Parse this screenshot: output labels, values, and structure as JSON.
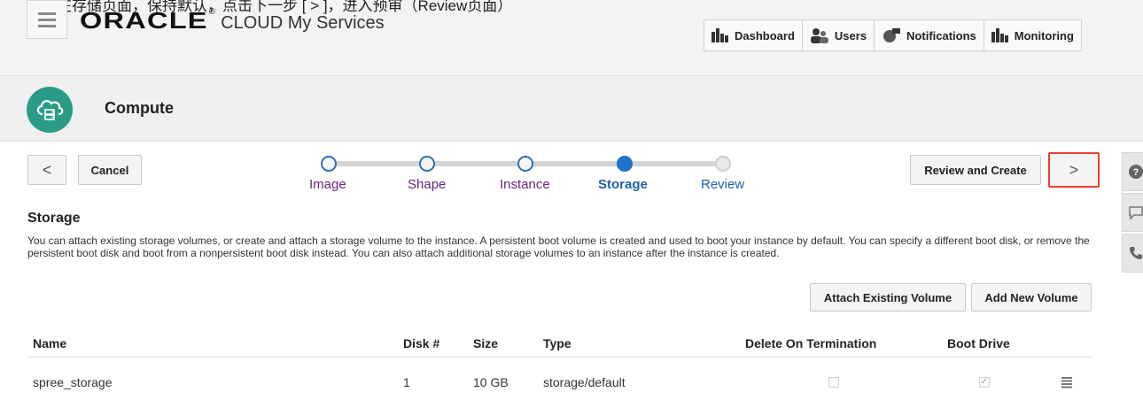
{
  "annotation": {
    "text": "在存储页面，保持默认，点击下一步 [ > ]，进入预审（Review页面）"
  },
  "header": {
    "brand_logo": "ORACLE",
    "brand_trademark": "®",
    "brand_rest": "CLOUD My Services",
    "nav": [
      {
        "label": "Dashboard",
        "icon": "bar-chart-icon"
      },
      {
        "label": "Users",
        "icon": "users-icon"
      },
      {
        "label": "Notifications",
        "icon": "notifications-icon"
      },
      {
        "label": "Monitoring",
        "icon": "bar-chart-icon"
      }
    ]
  },
  "page": {
    "title": "Compute",
    "icon": "cloud-compute-icon",
    "accent_color": "#2a9c86"
  },
  "toolbar": {
    "back_label": "<",
    "cancel_label": "Cancel",
    "review_label": "Review and Create",
    "next_label": ">",
    "highlight_color": "#e8402f"
  },
  "train": {
    "steps": [
      {
        "label": "Image",
        "state": "visited"
      },
      {
        "label": "Shape",
        "state": "visited"
      },
      {
        "label": "Instance",
        "state": "visited"
      },
      {
        "label": "Storage",
        "state": "current"
      },
      {
        "label": "Review",
        "state": "future"
      }
    ]
  },
  "storage": {
    "title": "Storage",
    "description": "You can attach existing storage volumes, or create and attach a storage volume to the instance. A persistent boot volume is created and used to boot your instance by default. You can specify a different boot disk, or remove the persistent boot disk and boot from a nonpersistent boot disk instead. You can also attach additional storage volumes to an instance after the instance is created.",
    "attach_label": "Attach Existing Volume",
    "add_label": "Add New Volume"
  },
  "table": {
    "columns": [
      "Name",
      "Disk #",
      "Size",
      "Type",
      "Delete On Termination",
      "Boot Drive"
    ],
    "rows": [
      {
        "name": "spree_storage",
        "disk": "1",
        "size": "10 GB",
        "type": "storage/default",
        "delete_on_termination": false,
        "boot_drive": true
      }
    ]
  }
}
